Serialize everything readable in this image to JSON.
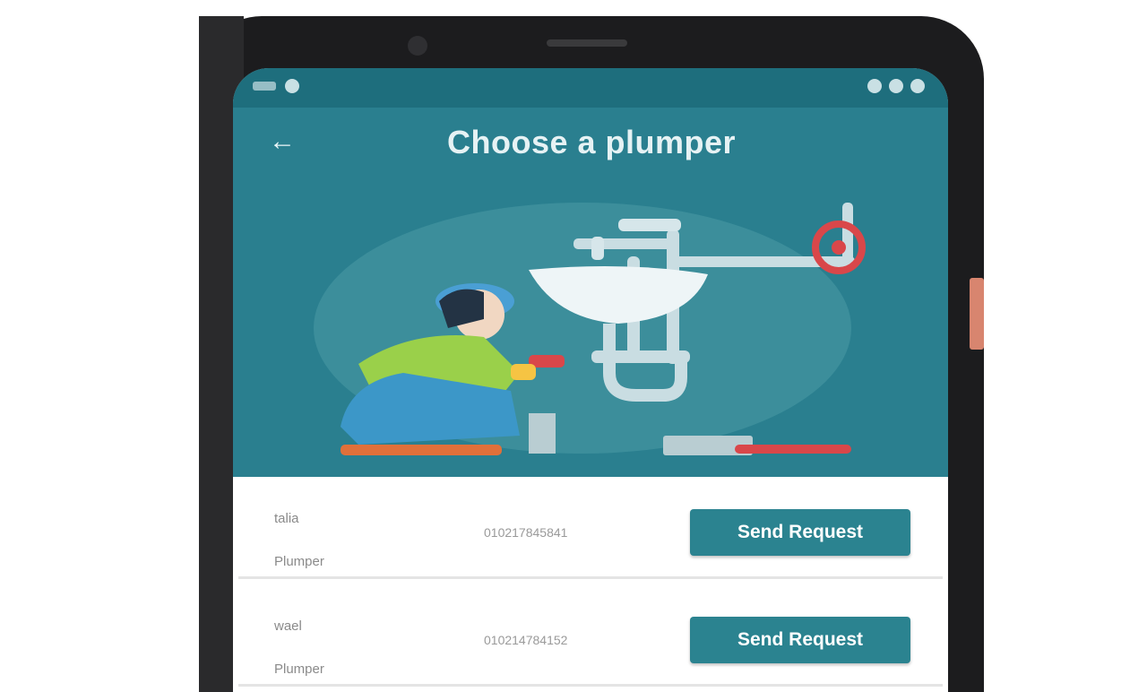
{
  "screen": {
    "title": "Choose a plumper",
    "back_icon": "arrow-left-icon"
  },
  "colors": {
    "header": "#2a7f8f",
    "status_bar": "#1e6e7d",
    "button": "#2b8390",
    "button_text": "#ffffff"
  },
  "plumbers": [
    {
      "name": "talia",
      "role": "Plumper",
      "phone": "010217845841",
      "action_label": "Send Request"
    },
    {
      "name": "wael",
      "role": "Plumper",
      "phone": "010214784152",
      "action_label": "Send Request"
    }
  ]
}
